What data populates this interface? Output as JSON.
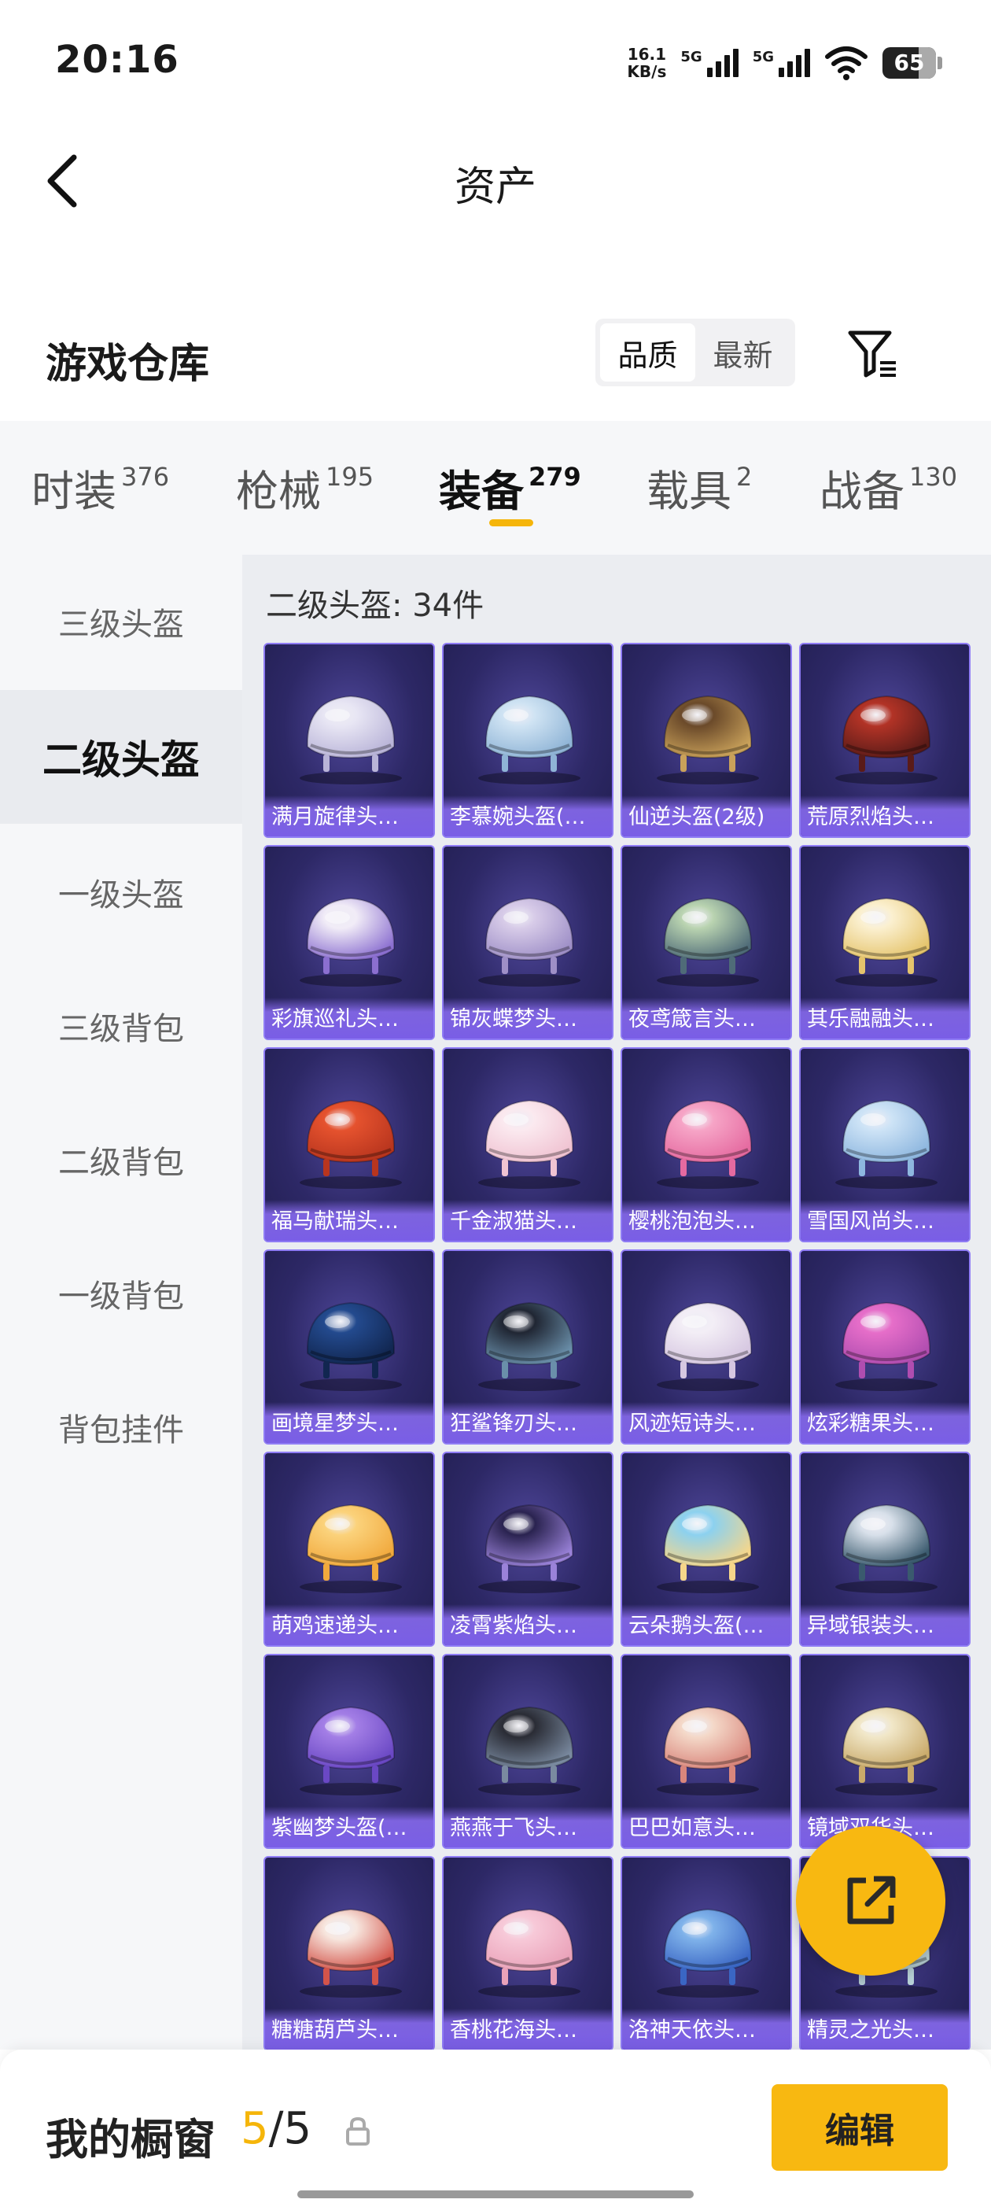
{
  "status": {
    "time": "20:16",
    "net_speed_value": "16.1",
    "net_speed_unit": "KB/s",
    "signal1": "5G",
    "signal2": "5G",
    "battery": "65"
  },
  "header": {
    "title": "资产"
  },
  "warehouse": {
    "title": "游戏仓库",
    "sort": {
      "quality": "品质",
      "latest": "最新",
      "active": "quality"
    }
  },
  "tabs": [
    {
      "label": "时装",
      "count": "376"
    },
    {
      "label": "枪械",
      "count": "195"
    },
    {
      "label": "装备",
      "count": "279",
      "active": true
    },
    {
      "label": "载具",
      "count": "2"
    },
    {
      "label": "战备",
      "count": "130"
    }
  ],
  "sidebar": {
    "items": [
      {
        "label": "三级头盔"
      },
      {
        "label": "二级头盔",
        "active": true
      },
      {
        "label": "一级头盔"
      },
      {
        "label": "三级背包"
      },
      {
        "label": "二级背包"
      },
      {
        "label": "一级背包"
      },
      {
        "label": "背包挂件"
      }
    ]
  },
  "content": {
    "count_label": "二级头盔: 34件",
    "items": [
      {
        "name": "满月旋律头…",
        "colors": [
          "#e8e6f4",
          "#b9b4d8"
        ]
      },
      {
        "name": "李慕婉头盔(…",
        "colors": [
          "#cfe3f3",
          "#8fb4d6"
        ]
      },
      {
        "name": "仙逆头盔(2级)",
        "colors": [
          "#6b4a2a",
          "#c9a15a"
        ]
      },
      {
        "name": "荒原烈焰头…",
        "colors": [
          "#b23326",
          "#5a1b18"
        ]
      },
      {
        "name": "彩旗巡礼头…",
        "colors": [
          "#f1ecf7",
          "#8b6fd0"
        ]
      },
      {
        "name": "锦灰蝶梦头…",
        "colors": [
          "#d7cbe8",
          "#9e8fc7"
        ]
      },
      {
        "name": "夜鸢箴言头…",
        "colors": [
          "#b9d3b0",
          "#4f6b78"
        ]
      },
      {
        "name": "其乐融融头…",
        "colors": [
          "#fbf0d0",
          "#e5c46c"
        ]
      },
      {
        "name": "福马献瑞头…",
        "colors": [
          "#e5522e",
          "#b8351e"
        ]
      },
      {
        "name": "千金淑猫头…",
        "colors": [
          "#fbe9ef",
          "#f0c3d2"
        ]
      },
      {
        "name": "樱桃泡泡头…",
        "colors": [
          "#f6a4c6",
          "#e56aa0"
        ]
      },
      {
        "name": "雪国风尚头…",
        "colors": [
          "#cde3f6",
          "#8eb7df"
        ]
      },
      {
        "name": "画境星梦头…",
        "colors": [
          "#234a8e",
          "#112650"
        ]
      },
      {
        "name": "狂鲨锋刃头…",
        "colors": [
          "#202633",
          "#6a8faa"
        ]
      },
      {
        "name": "风迹短诗头…",
        "colors": [
          "#f3eef6",
          "#d6c7e1"
        ]
      },
      {
        "name": "炫彩糖果头…",
        "colors": [
          "#e66ec9",
          "#b04db0"
        ]
      },
      {
        "name": "萌鸡速递头…",
        "colors": [
          "#fbd27b",
          "#f1a93d"
        ]
      },
      {
        "name": "凌霄紫焰头…",
        "colors": [
          "#2a2350",
          "#9a82d9"
        ]
      },
      {
        "name": "云朵鹅头盔(…",
        "colors": [
          "#8cd1ef",
          "#f6d68a"
        ]
      },
      {
        "name": "异域银装头…",
        "colors": [
          "#d8e0ea",
          "#3a5a6e"
        ]
      },
      {
        "name": "紫幽梦头盔(…",
        "colors": [
          "#a37ee6",
          "#6a48c4"
        ]
      },
      {
        "name": "燕燕于飞头…",
        "colors": [
          "#2a2c35",
          "#7a8aa0"
        ]
      },
      {
        "name": "巴巴如意头…",
        "colors": [
          "#f4d8c8",
          "#d9867c"
        ]
      },
      {
        "name": "镜域双华头…",
        "colors": [
          "#f1e7c8",
          "#c9aa6a"
        ]
      },
      {
        "name": "糖糖葫芦头…",
        "colors": [
          "#f7e6de",
          "#d3544a"
        ]
      },
      {
        "name": "香桃花海头…",
        "colors": [
          "#f7c9d8",
          "#eaa2b9"
        ]
      },
      {
        "name": "洛神天依头…",
        "colors": [
          "#7fb2ea",
          "#3a66c4"
        ]
      },
      {
        "name": "精灵之光头…",
        "colors": [
          "#e9f2f4",
          "#b9d2d8"
        ]
      }
    ]
  },
  "bottom": {
    "label": "我的橱窗",
    "current": "5",
    "separator": "/",
    "total": "5",
    "edit": "编辑"
  }
}
